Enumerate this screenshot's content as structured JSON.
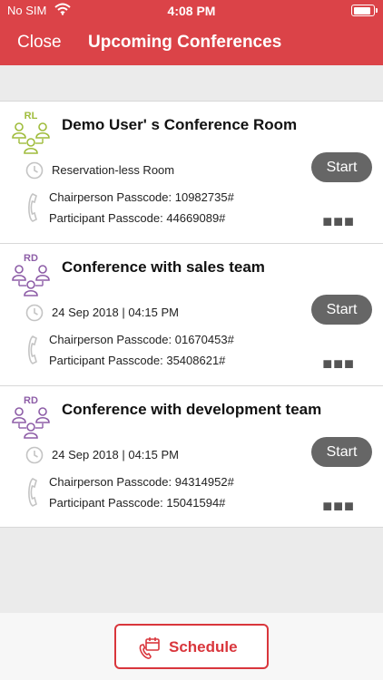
{
  "status_bar": {
    "carrier": "No SIM",
    "time": "4:08 PM"
  },
  "nav": {
    "close": "Close",
    "title": "Upcoming Conferences"
  },
  "conferences": [
    {
      "initials": "RL",
      "initials_color": "#9fbc3b",
      "name": "Demo User' s Conference Room",
      "when": "Reservation-less Room",
      "chair": "Chairperson Passcode: 10982735#",
      "participant": "Participant Passcode: 44669089#",
      "start": "Start",
      "more": "■■■"
    },
    {
      "initials": "RD",
      "initials_color": "#8d5da7",
      "name": "Conference with sales team",
      "when": "24 Sep 2018 | 04:15 PM",
      "chair": "Chairperson Passcode: 01670453#",
      "participant": "Participant Passcode: 35408621#",
      "start": "Start",
      "more": "■■■"
    },
    {
      "initials": "RD",
      "initials_color": "#8d5da7",
      "name": "Conference with development team",
      "when": "24 Sep 2018 | 04:15 PM",
      "chair": "Chairperson Passcode: 94314952#",
      "participant": "Participant Passcode: 15041594#",
      "start": "Start",
      "more": "■■■"
    }
  ],
  "footer": {
    "schedule": "Schedule"
  },
  "colors": {
    "brand_red": "#db4348",
    "start_gray": "#666666"
  }
}
